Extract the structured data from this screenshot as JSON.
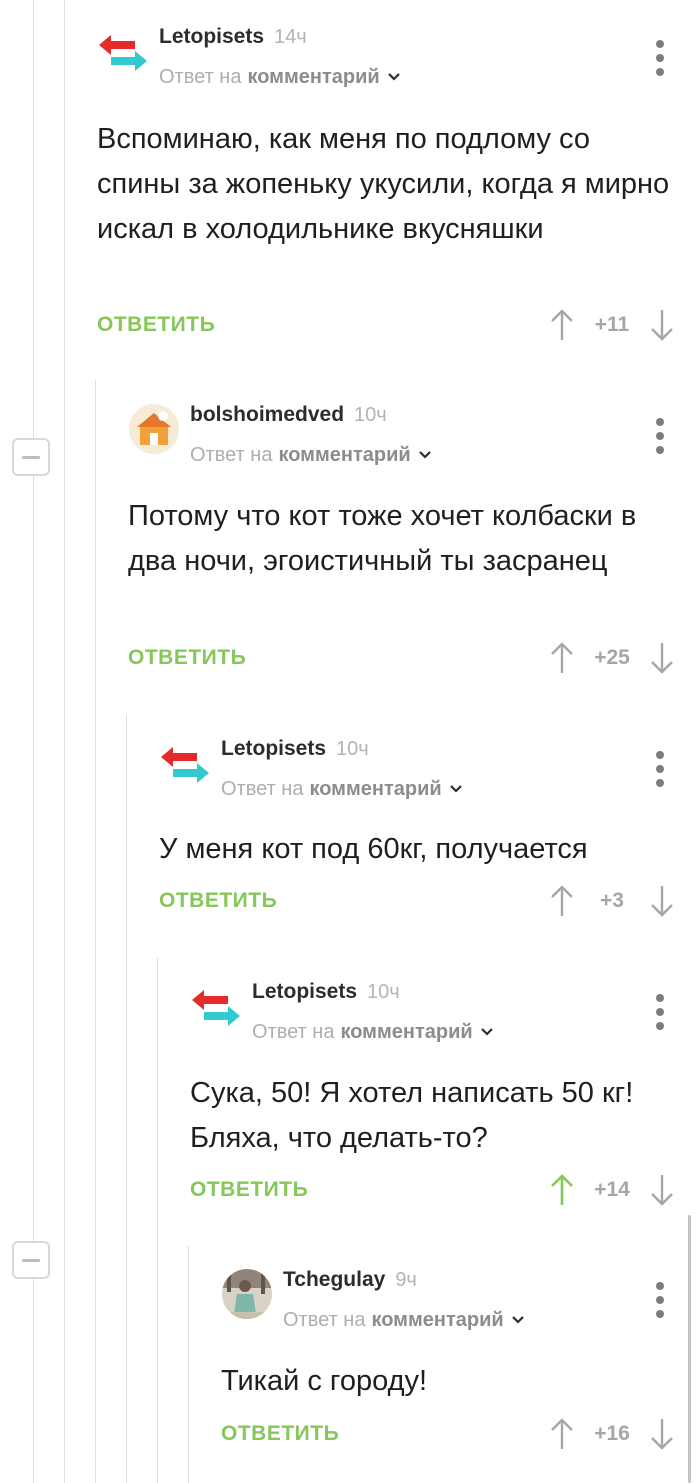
{
  "reply_prefix": "Ответ на",
  "reply_target": "комментарий",
  "reply_button": "ОТВЕТИТЬ",
  "colors": {
    "accent_green": "#86c75a",
    "vote_gray": "#a6a6a6",
    "rail_gray": "#dedede"
  },
  "comments": [
    {
      "author": "Letopisets",
      "time": "14ч",
      "avatar": "arrows-logo-avatar",
      "text": "Вспоминаю, как меня по подлому со спины за жопеньку укусили, когда я мирно искал в холодильнике вкусняшки",
      "score": "+11",
      "upvoted": false
    },
    {
      "author": "bolshoimedved",
      "time": "10ч",
      "avatar": "house-illustration-avatar",
      "text": "Потому что кот тоже хочет колбаски в два ночи, эгоистичный ты засранец",
      "score": "+25",
      "upvoted": false
    },
    {
      "author": "Letopisets",
      "time": "10ч",
      "avatar": "arrows-logo-avatar",
      "text": "У меня кот под 60кг, получается",
      "score": "+3",
      "upvoted": false
    },
    {
      "author": "Letopisets",
      "time": "10ч",
      "avatar": "arrows-logo-avatar",
      "text": "Сука, 50! Я хотел написать 50 кг! Бляха, что делать-то?",
      "score": "+14",
      "upvoted": true
    },
    {
      "author": "Tchegulay",
      "time": "9ч",
      "avatar": "person-photo-avatar",
      "text": "Тикай с городу!",
      "score": "+16",
      "upvoted": false
    }
  ]
}
